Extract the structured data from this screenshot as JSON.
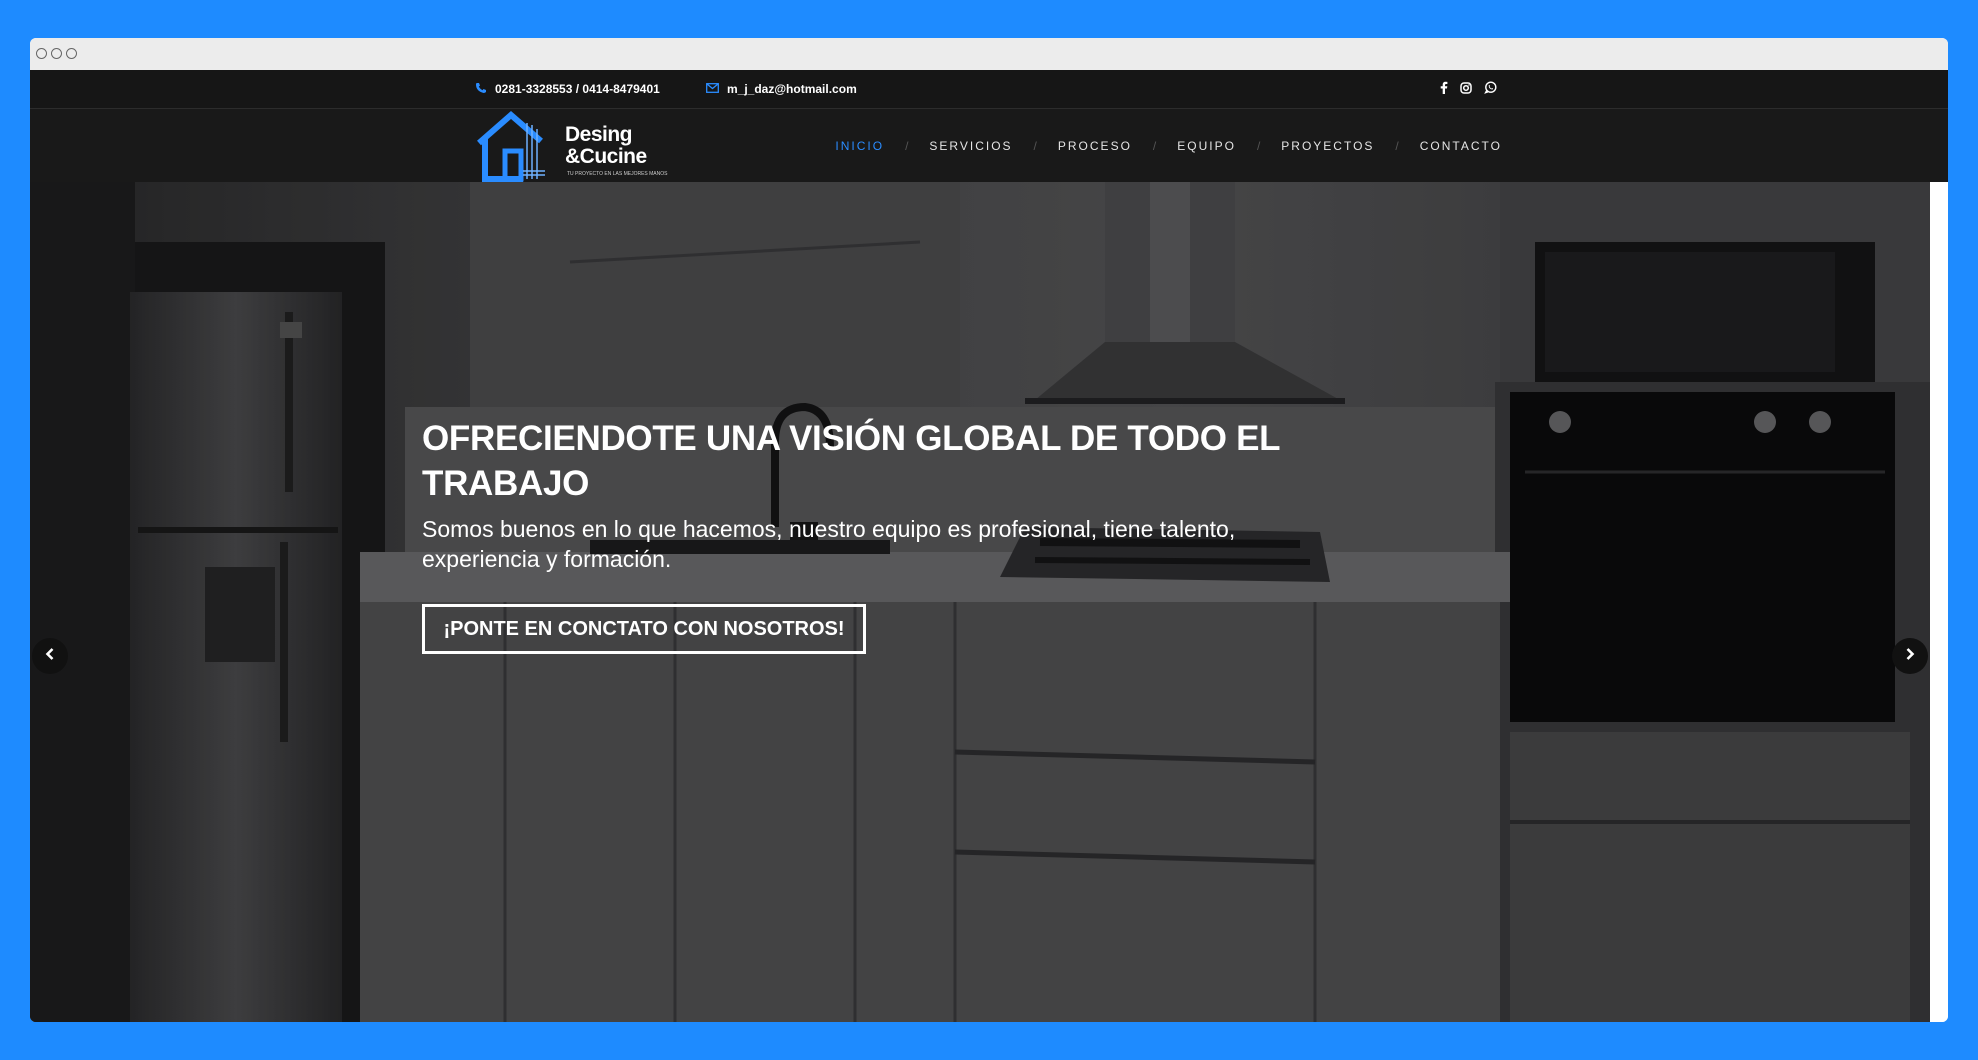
{
  "topbar": {
    "phone_icon": "phone-icon",
    "phone": "0281-3328553 / 0414-8479401",
    "email_icon": "envelope-icon",
    "email": "m_j_daz@hotmail.com",
    "social": [
      "facebook-icon",
      "instagram-icon",
      "whatsapp-icon"
    ]
  },
  "logo": {
    "line1": "Desing",
    "line2": "&Cucine",
    "tagline": "TU PROYECTO EN LAS MEJORES MANOS"
  },
  "nav": {
    "items": [
      "INICIO",
      "SERVICIOS",
      "PROCESO",
      "EQUIPO",
      "PROYECTOS",
      "CONTACTO"
    ],
    "separator": "/",
    "active_index": 0
  },
  "hero": {
    "title": "OFRECIENDOTE UNA VISIÓN GLOBAL DE TODO EL TRABAJO",
    "subtitle": "Somos buenos en lo que hacemos, nuestro equipo es profesional, tiene talento, experiencia y formación.",
    "cta": "¡PONTE EN CONCTATO CON NOSOTROS!",
    "prev_icon": "chevron-left-icon",
    "next_icon": "chevron-right-icon"
  },
  "colors": {
    "accent": "#2a8cff",
    "page_bg": "#1e8bff",
    "header_bg": "#191919",
    "topbar_bg": "#161616"
  }
}
